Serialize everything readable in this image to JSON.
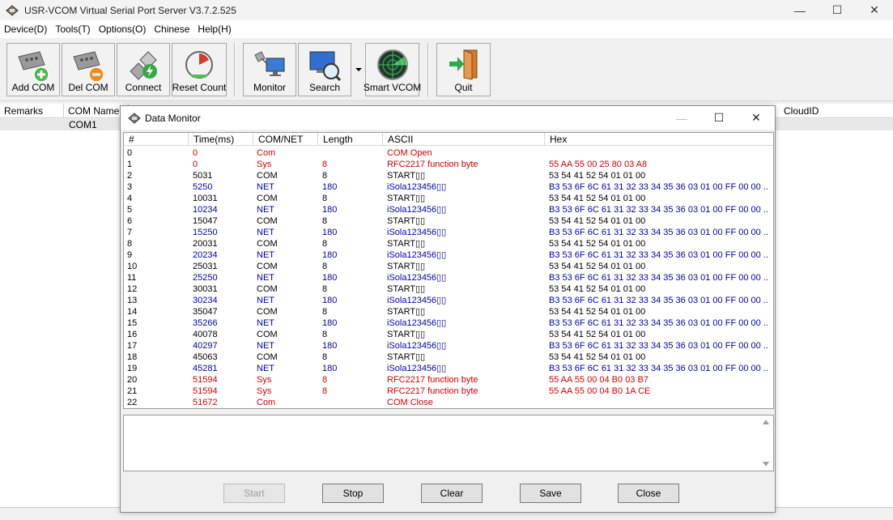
{
  "window": {
    "title": "USR-VCOM Virtual Serial Port Server V3.7.2.525",
    "minimize": "—",
    "maximize": "☐",
    "close": "✕"
  },
  "menu": [
    "Device(D)",
    "Tools(T)",
    "Options(O)",
    "Chinese",
    "Help(H)"
  ],
  "toolbar": {
    "add_com": "Add COM",
    "del_com": "Del COM",
    "connect": "Connect",
    "reset_count": "Reset Count",
    "monitor": "Monitor",
    "search": "Search",
    "smart_vcom": "Smart VCOM",
    "quit": "Quit"
  },
  "main_grid": {
    "col_remarks": "Remarks",
    "col_com_name": "COM Name",
    "col_cloudid": "CloudID",
    "row1_com": "COM1"
  },
  "dialog": {
    "title": "Data Monitor",
    "minimize": "—",
    "maximize": "☐",
    "close": "✕",
    "headers": {
      "idx": "#",
      "time": "Time(ms)",
      "comnet": "COM/NET",
      "length": "Length",
      "ascii": "ASCII",
      "hex": "Hex"
    },
    "rows": [
      {
        "idx": "0",
        "time": "0",
        "net": "Com",
        "len": "",
        "ascii": "COM Open",
        "hex": "",
        "color": "red"
      },
      {
        "idx": "1",
        "time": "0",
        "net": "Sys",
        "len": "8",
        "ascii": "RFC2217 function byte",
        "hex": "55 AA 55 00 25 80 03 A8",
        "color": "red"
      },
      {
        "idx": "2",
        "time": "5031",
        "net": "COM",
        "len": "8",
        "ascii": "START▯▯",
        "hex": "53 54 41 52 54 01 01 00",
        "color": "black"
      },
      {
        "idx": "3",
        "time": "5250",
        "net": "NET",
        "len": "180",
        "ascii": "iSola123456▯▯",
        "hex": "B3 53 6F 6C 61 31 32 33 34 35 36 03 01 00 FF 00 00 ...",
        "color": "blue"
      },
      {
        "idx": "4",
        "time": "10031",
        "net": "COM",
        "len": "8",
        "ascii": "START▯▯",
        "hex": "53 54 41 52 54 01 01 00",
        "color": "black"
      },
      {
        "idx": "5",
        "time": "10234",
        "net": "NET",
        "len": "180",
        "ascii": "iSola123456▯▯",
        "hex": "B3 53 6F 6C 61 31 32 33 34 35 36 03 01 00 FF 00 00 ...",
        "color": "blue"
      },
      {
        "idx": "6",
        "time": "15047",
        "net": "COM",
        "len": "8",
        "ascii": "START▯▯",
        "hex": "53 54 41 52 54 01 01 00",
        "color": "black"
      },
      {
        "idx": "7",
        "time": "15250",
        "net": "NET",
        "len": "180",
        "ascii": "iSola123456▯▯",
        "hex": "B3 53 6F 6C 61 31 32 33 34 35 36 03 01 00 FF 00 00 ...",
        "color": "blue"
      },
      {
        "idx": "8",
        "time": "20031",
        "net": "COM",
        "len": "8",
        "ascii": "START▯▯",
        "hex": "53 54 41 52 54 01 01 00",
        "color": "black"
      },
      {
        "idx": "9",
        "time": "20234",
        "net": "NET",
        "len": "180",
        "ascii": "iSola123456▯▯",
        "hex": "B3 53 6F 6C 61 31 32 33 34 35 36 03 01 00 FF 00 00 ...",
        "color": "blue"
      },
      {
        "idx": "10",
        "time": "25031",
        "net": "COM",
        "len": "8",
        "ascii": "START▯▯",
        "hex": "53 54 41 52 54 01 01 00",
        "color": "black"
      },
      {
        "idx": "11",
        "time": "25250",
        "net": "NET",
        "len": "180",
        "ascii": "iSola123456▯▯",
        "hex": "B3 53 6F 6C 61 31 32 33 34 35 36 03 01 00 FF 00 00 ...",
        "color": "blue"
      },
      {
        "idx": "12",
        "time": "30031",
        "net": "COM",
        "len": "8",
        "ascii": "START▯▯",
        "hex": "53 54 41 52 54 01 01 00",
        "color": "black"
      },
      {
        "idx": "13",
        "time": "30234",
        "net": "NET",
        "len": "180",
        "ascii": "iSola123456▯▯",
        "hex": "B3 53 6F 6C 61 31 32 33 34 35 36 03 01 00 FF 00 00 ...",
        "color": "blue"
      },
      {
        "idx": "14",
        "time": "35047",
        "net": "COM",
        "len": "8",
        "ascii": "START▯▯",
        "hex": "53 54 41 52 54 01 01 00",
        "color": "black"
      },
      {
        "idx": "15",
        "time": "35266",
        "net": "NET",
        "len": "180",
        "ascii": "iSola123456▯▯",
        "hex": "B3 53 6F 6C 61 31 32 33 34 35 36 03 01 00 FF 00 00 ...",
        "color": "blue"
      },
      {
        "idx": "16",
        "time": "40078",
        "net": "COM",
        "len": "8",
        "ascii": "START▯▯",
        "hex": "53 54 41 52 54 01 01 00",
        "color": "black"
      },
      {
        "idx": "17",
        "time": "40297",
        "net": "NET",
        "len": "180",
        "ascii": "iSola123456▯▯",
        "hex": "B3 53 6F 6C 61 31 32 33 34 35 36 03 01 00 FF 00 00 ...",
        "color": "blue"
      },
      {
        "idx": "18",
        "time": "45063",
        "net": "COM",
        "len": "8",
        "ascii": "START▯▯",
        "hex": "53 54 41 52 54 01 01 00",
        "color": "black"
      },
      {
        "idx": "19",
        "time": "45281",
        "net": "NET",
        "len": "180",
        "ascii": "iSola123456▯▯",
        "hex": "B3 53 6F 6C 61 31 32 33 34 35 36 03 01 00 FF 00 00 ...",
        "color": "blue"
      },
      {
        "idx": "20",
        "time": "51594",
        "net": "Sys",
        "len": "8",
        "ascii": "RFC2217 function byte",
        "hex": "55 AA 55 00 04 B0 03 B7",
        "color": "red"
      },
      {
        "idx": "21",
        "time": "51594",
        "net": "Sys",
        "len": "8",
        "ascii": "RFC2217 function byte",
        "hex": "55 AA 55 00 04 B0 1A CE",
        "color": "red"
      },
      {
        "idx": "22",
        "time": "51672",
        "net": "Com",
        "len": "",
        "ascii": "COM Close",
        "hex": "",
        "color": "red"
      }
    ],
    "buttons": {
      "start": "Start",
      "stop": "Stop",
      "clear": "Clear",
      "save": "Save",
      "close": "Close"
    }
  },
  "colors": {
    "sys_event": "#d00000",
    "net_data": "#0000a8",
    "com_data": "#000000"
  }
}
